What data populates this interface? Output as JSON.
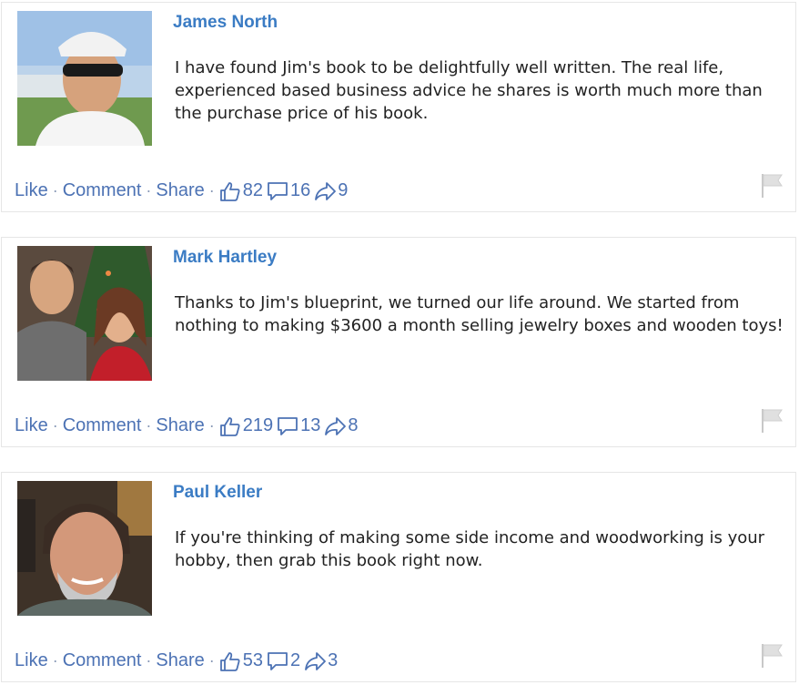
{
  "posts": [
    {
      "name": "James North",
      "text": "I have found Jim's book to be delightfully well written. The real life, experienced based business advice he shares is worth much more than the purchase price of his book.",
      "likes": "82",
      "comments": "16",
      "shares": "9"
    },
    {
      "name": "Mark Hartley",
      "text": "Thanks to Jim's blueprint, we turned our life around. We started from nothing to making $3600 a month selling jewelry boxes and wooden toys!",
      "likes": "219",
      "comments": "13",
      "shares": "8"
    },
    {
      "name": "Paul Keller",
      "text": "If you're thinking of making some side income and woodworking is your hobby, then grab this book right now.",
      "likes": "53",
      "comments": "2",
      "shares": "3"
    }
  ],
  "actions": {
    "like": "Like",
    "comment": "Comment",
    "share": "Share"
  },
  "icons": {
    "like": "thumbs-up-icon",
    "comment": "speech-bubble-icon",
    "share": "share-arrow-icon",
    "report": "flag-icon"
  },
  "colors": {
    "link": "#4c72b4",
    "name": "#3b7cc4",
    "text": "#222222",
    "border": "#e6e6e6"
  }
}
